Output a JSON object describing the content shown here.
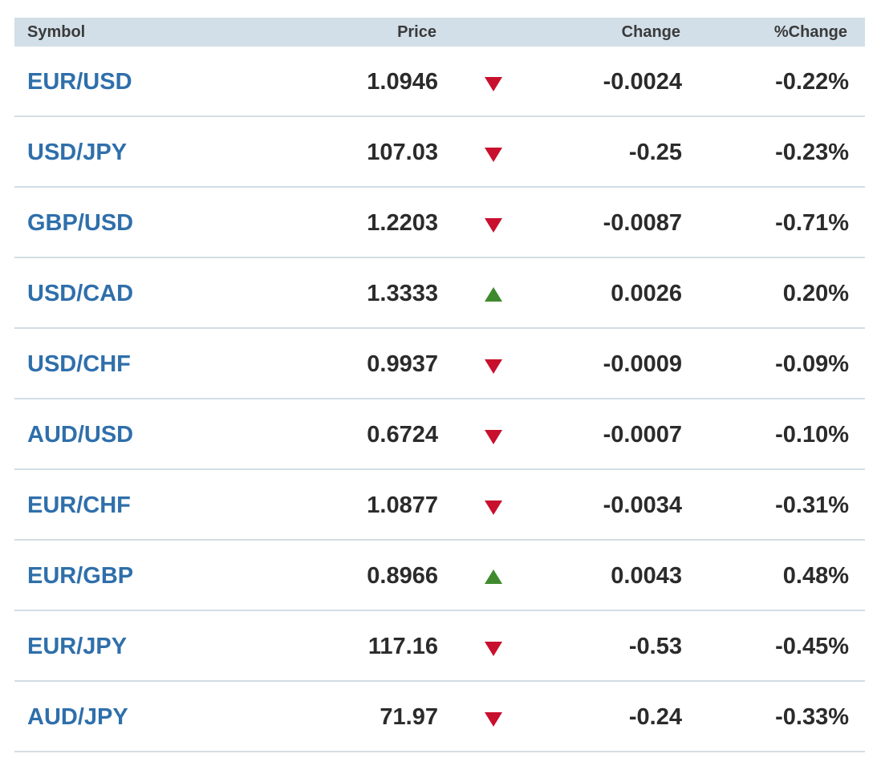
{
  "header": {
    "symbol": "Symbol",
    "price": "Price",
    "change": "Change",
    "pct_change": "%Change"
  },
  "colors": {
    "header_bg": "#d2dfe8",
    "symbol_link": "#2f6fab",
    "down": "#c8102e",
    "up": "#3f8a2e",
    "divider": "#d3dde4"
  },
  "rows": [
    {
      "symbol": "EUR/USD",
      "price": "1.0946",
      "direction": "down",
      "direction_icon": "triangle-down-icon",
      "change": "-0.0024",
      "pct_change": "-0.22%"
    },
    {
      "symbol": "USD/JPY",
      "price": "107.03",
      "direction": "down",
      "direction_icon": "triangle-down-icon",
      "change": "-0.25",
      "pct_change": "-0.23%"
    },
    {
      "symbol": "GBP/USD",
      "price": "1.2203",
      "direction": "down",
      "direction_icon": "triangle-down-icon",
      "change": "-0.0087",
      "pct_change": "-0.71%"
    },
    {
      "symbol": "USD/CAD",
      "price": "1.3333",
      "direction": "up",
      "direction_icon": "triangle-up-icon",
      "change": "0.0026",
      "pct_change": "0.20%"
    },
    {
      "symbol": "USD/CHF",
      "price": "0.9937",
      "direction": "down",
      "direction_icon": "triangle-down-icon",
      "change": "-0.0009",
      "pct_change": "-0.09%"
    },
    {
      "symbol": "AUD/USD",
      "price": "0.6724",
      "direction": "down",
      "direction_icon": "triangle-down-icon",
      "change": "-0.0007",
      "pct_change": "-0.10%"
    },
    {
      "symbol": "EUR/CHF",
      "price": "1.0877",
      "direction": "down",
      "direction_icon": "triangle-down-icon",
      "change": "-0.0034",
      "pct_change": "-0.31%"
    },
    {
      "symbol": "EUR/GBP",
      "price": "0.8966",
      "direction": "up",
      "direction_icon": "triangle-up-icon",
      "change": "0.0043",
      "pct_change": "0.48%"
    },
    {
      "symbol": "EUR/JPY",
      "price": "117.16",
      "direction": "down",
      "direction_icon": "triangle-down-icon",
      "change": "-0.53",
      "pct_change": "-0.45%"
    },
    {
      "symbol": "AUD/JPY",
      "price": "71.97",
      "direction": "down",
      "direction_icon": "triangle-down-icon",
      "change": "-0.24",
      "pct_change": "-0.33%"
    }
  ]
}
